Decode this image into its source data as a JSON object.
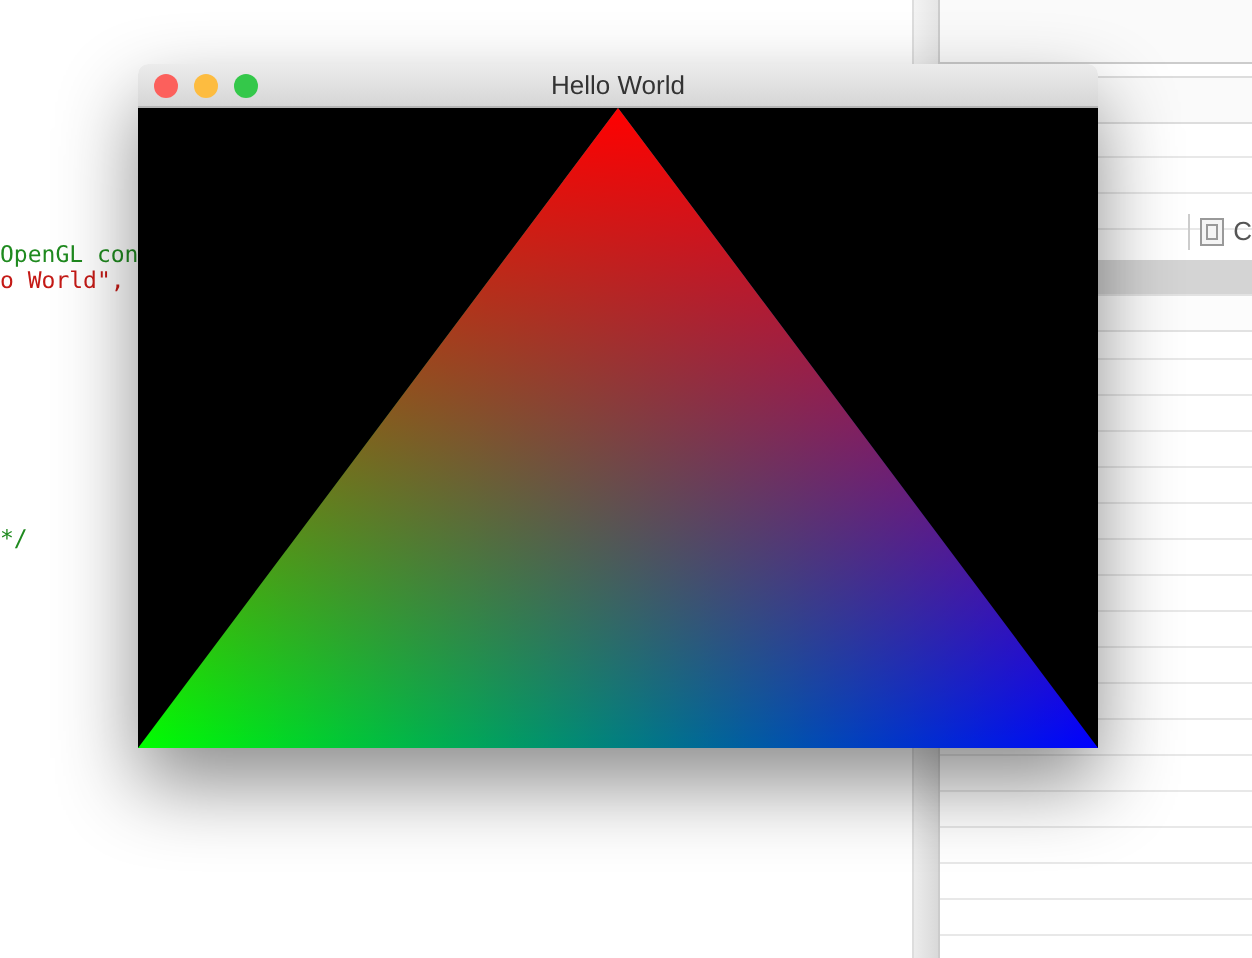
{
  "editor": {
    "lines": [
      {
        "text": "OpenGL con",
        "kind": "comment"
      },
      {
        "text": "o World\",",
        "kind": "string"
      },
      {
        "text": "*/",
        "kind": "comment"
      }
    ]
  },
  "side_panel": {
    "toolbar_label": "C",
    "rows": [
      {
        "selected": true
      },
      {
        "selected": false
      }
    ]
  },
  "window": {
    "title": "Hello World"
  }
}
